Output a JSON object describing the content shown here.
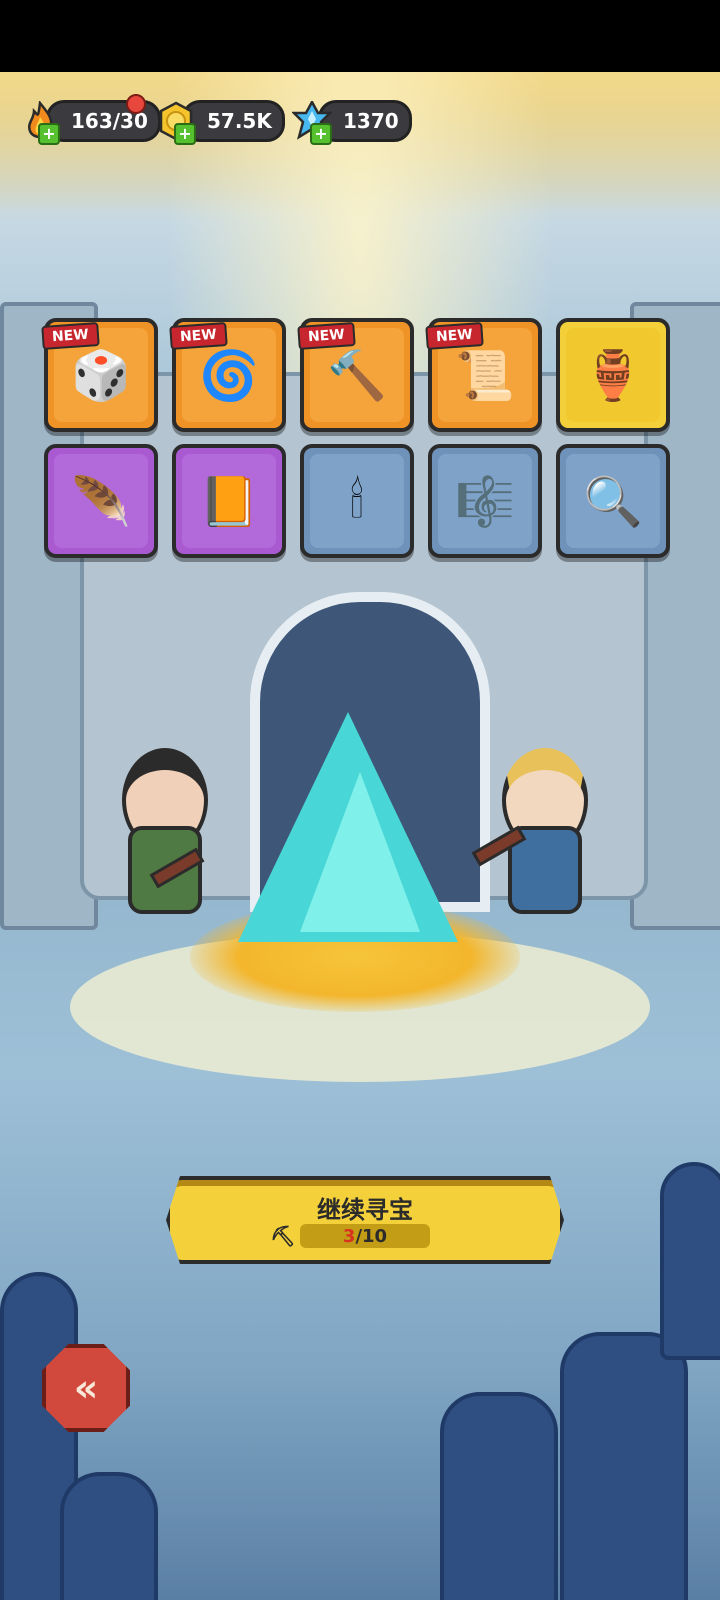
{
  "hud": {
    "energy": "163/30",
    "gold": "57.5K",
    "gems": "1370"
  },
  "items": [
    {
      "name": "d20-dice-icon",
      "glyph": "🎲",
      "rarity": "orange",
      "new": "NEW"
    },
    {
      "name": "blue-spirit-orb-icon",
      "glyph": "🌀",
      "rarity": "orange",
      "new": "NEW"
    },
    {
      "name": "war-hammer-icon",
      "glyph": "🔨",
      "rarity": "orange",
      "new": "NEW"
    },
    {
      "name": "scroll-letter-icon",
      "glyph": "📜",
      "rarity": "orange",
      "new": "NEW"
    },
    {
      "name": "sand-vase-icon",
      "glyph": "🏺",
      "rarity": "gold",
      "new": ""
    },
    {
      "name": "fire-feather-icon",
      "glyph": "🪶",
      "rarity": "purple",
      "new": ""
    },
    {
      "name": "lightning-book-icon",
      "glyph": "📙",
      "rarity": "purple",
      "new": ""
    },
    {
      "name": "candle-icon",
      "glyph": "🕯",
      "rarity": "blue",
      "new": ""
    },
    {
      "name": "lyre-icon",
      "glyph": "🎼",
      "rarity": "blue",
      "new": ""
    },
    {
      "name": "magnifying-mirror-icon",
      "glyph": "🔍",
      "rarity": "blue",
      "new": ""
    }
  ],
  "continue": {
    "label": "继续寻宝",
    "current": "3",
    "total": "/10"
  },
  "back": {
    "glyph": "«"
  },
  "colors": {
    "orange": "#f09327",
    "gold": "#f3d03a",
    "purple": "#a95ad1",
    "blue": "#6f92ba",
    "button": "#f4d13b",
    "back": "#d1483c"
  }
}
